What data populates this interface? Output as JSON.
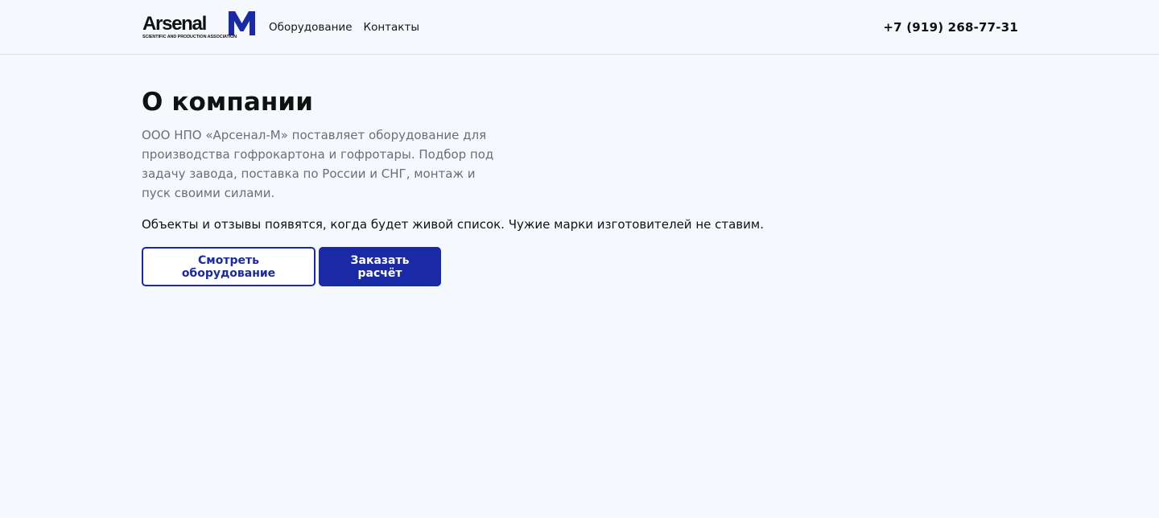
{
  "header": {
    "logo": {
      "word": "Arsenal",
      "letter": "M",
      "tagline": "SCIENTIFIC AND PRODUCTION ASSOCIATION"
    },
    "nav": [
      {
        "label": "Оборудование"
      },
      {
        "label": "Контакты"
      }
    ],
    "phone": "+7 (919) 268-77-31"
  },
  "main": {
    "title": "О компании",
    "lead": "ООО НПО «Арсенал-М» поставляет оборудование для производства гофрокартона и гофротары. Подбор под задачу завода, поставка по России и СНГ, монтаж и пуск своими силами.",
    "note": "Объекты и отзывы появятся, когда будет живой список. Чужие марки изготовителей не ставим.",
    "buttons": {
      "secondary": "Смотреть оборудование",
      "primary": "Заказать расчёт"
    }
  },
  "colors": {
    "accent": "#1a2aa6",
    "background": "#f5f8fc",
    "text": "#111111",
    "muted_text": "#6b6f76",
    "divider": "#dfe3ea"
  }
}
